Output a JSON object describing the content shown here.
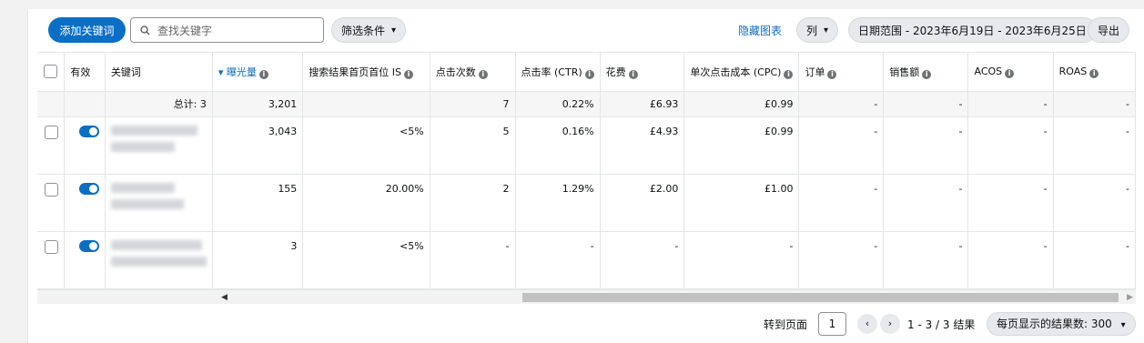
{
  "toolbar": {
    "add_keyword": "添加关键词",
    "search_placeholder": "查找关键字",
    "filter_label": "筛选条件",
    "hide_chart": "隐藏图表",
    "columns_label": "列",
    "date_range": "日期范围 - 2023年6月19日 - 2023年6月25日",
    "export_label": "导出"
  },
  "table": {
    "headers": {
      "enabled": "有效",
      "keyword": "关键词",
      "impressions": "曝光量",
      "top_of_search_is": "搜索结果首页首位 IS",
      "clicks": "点击次数",
      "ctr": "点击率 (CTR)",
      "spend": "花费",
      "cpc": "单次点击成本 (CPC)",
      "orders": "订单",
      "sales": "销售额",
      "acos": "ACOS",
      "roas": "ROAS"
    },
    "total": {
      "label": "总计: 3",
      "impressions": "3,201",
      "top_of_search_is": "",
      "clicks": "7",
      "ctr": "0.22%",
      "spend": "£6.93",
      "cpc": "£0.99",
      "orders": "-",
      "sales": "-",
      "acos": "-",
      "roas": "-"
    },
    "rows": [
      {
        "impressions": "3,043",
        "top_of_search_is": "<5%",
        "clicks": "5",
        "ctr": "0.16%",
        "spend": "£4.93",
        "cpc": "£0.99",
        "orders": "-",
        "sales": "-",
        "acos": "-",
        "roas": "-"
      },
      {
        "impressions": "155",
        "top_of_search_is": "20.00%",
        "clicks": "2",
        "ctr": "1.29%",
        "spend": "£2.00",
        "cpc": "£1.00",
        "orders": "-",
        "sales": "-",
        "acos": "-",
        "roas": "-"
      },
      {
        "impressions": "3",
        "top_of_search_is": "<5%",
        "clicks": "-",
        "ctr": "-",
        "spend": "-",
        "cpc": "-",
        "orders": "-",
        "sales": "-",
        "acos": "-",
        "roas": "-"
      }
    ]
  },
  "footer": {
    "goto_page": "转到页面",
    "page_value": "1",
    "results": "1 - 3 / 3 结果",
    "per_page": "每页显示的结果数: 300"
  },
  "colors": {
    "accent": "#0a6ec5"
  }
}
